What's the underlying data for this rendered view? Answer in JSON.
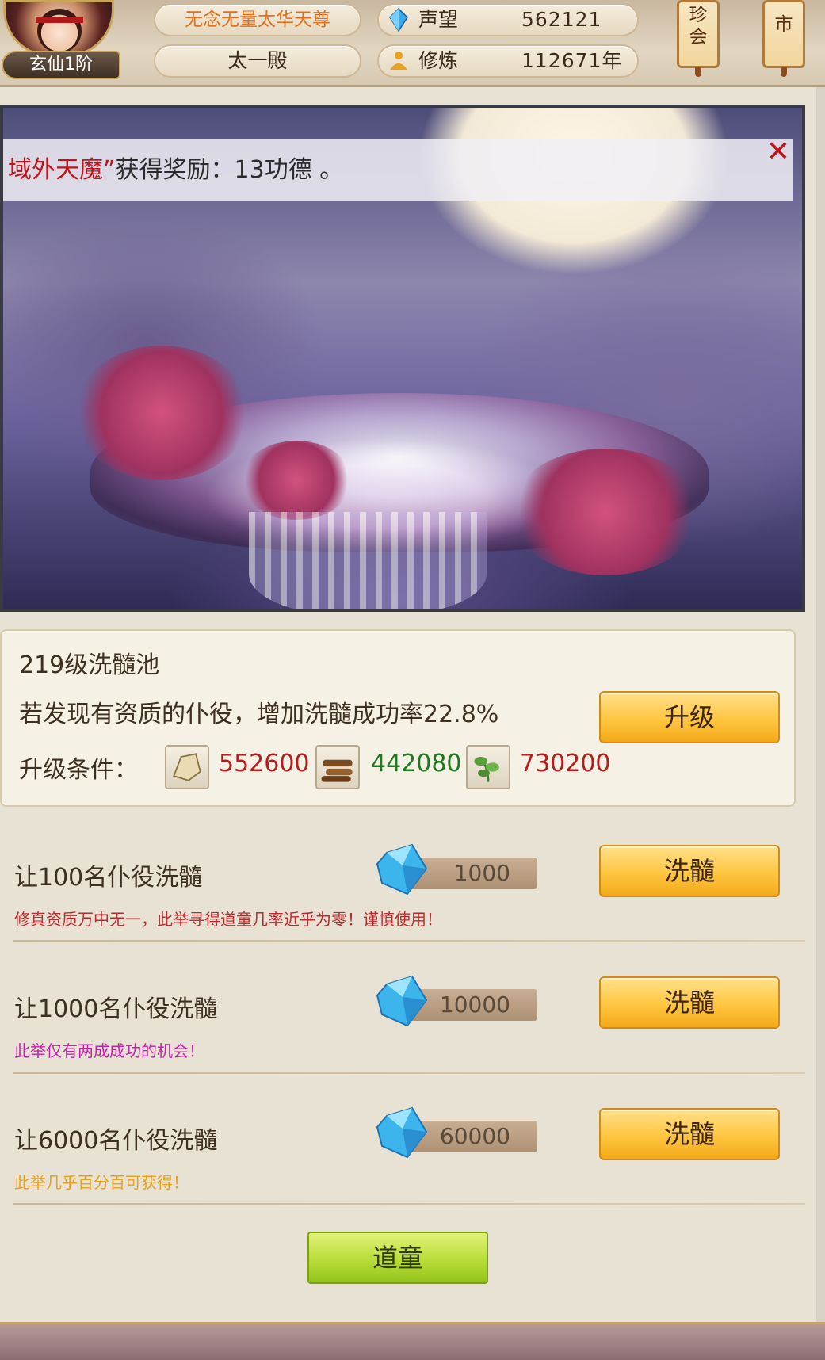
{
  "player": {
    "rank": "玄仙1阶",
    "title": "无念无量太华天尊",
    "hall": "太一殿",
    "reputation_label": "声望",
    "reputation_value": "562121",
    "cultivation_label": "修炼",
    "cultivation_value": "112671年"
  },
  "top_buttons": {
    "treasure": "珍\n会",
    "market": "市"
  },
  "notice": {
    "highlight": "域外天魔”",
    "text": "获得奖励：13功德 。"
  },
  "pool": {
    "title": "219级洗髓池",
    "description": "若发现有资质的仆役，增加洗髓成功率22.8%",
    "upgrade_button": "升级",
    "condition_label": "升级条件：",
    "resources": [
      {
        "icon": "stone-icon",
        "value": "552600",
        "color": "#b51c1c"
      },
      {
        "icon": "wood-icon",
        "value": "442080",
        "color": "#1f7a1f"
      },
      {
        "icon": "herb-icon",
        "value": "730200",
        "color": "#b51c1c"
      }
    ]
  },
  "wash_options": [
    {
      "title": "让100名仆役洗髓",
      "cost": "1000",
      "hint": "修真资质万中无一，此举寻得道童几率近乎为零！谨慎使用！",
      "hint_color": "#c0282c",
      "button": "洗髓"
    },
    {
      "title": "让1000名仆役洗髓",
      "cost": "10000",
      "hint": "此举仅有两成成功的机会！",
      "hint_color": "#c221a8",
      "button": "洗髓"
    },
    {
      "title": "让6000名仆役洗髓",
      "cost": "60000",
      "hint": "此举几乎百分百可获得！",
      "hint_color": "#e8a21a",
      "button": "洗髓"
    }
  ],
  "daotong_button": "道童"
}
